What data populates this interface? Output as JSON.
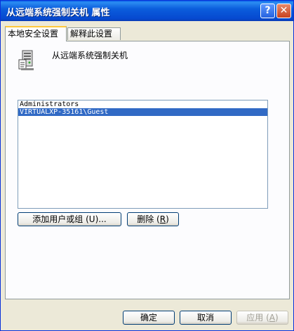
{
  "window": {
    "title": "从远端系统强制关机 属性",
    "help_label": "?",
    "close_label": "✕"
  },
  "tabs": [
    {
      "label": "本地安全设置",
      "active": true
    },
    {
      "label": "解释此设置",
      "active": false
    }
  ],
  "policy": {
    "icon": "server-policy-icon",
    "name": "从远端系统强制关机"
  },
  "accounts": [
    {
      "name": "Administrators",
      "selected": false
    },
    {
      "name": "VIRTUALXP-35161\\Guest",
      "selected": true
    }
  ],
  "buttons": {
    "add": {
      "text": "添加用户或组",
      "mnemonic": "(U)...",
      "pre": "",
      "key": "U",
      "post": ")..."
    },
    "remove": {
      "text": "删除",
      "key": "R"
    },
    "ok": "确定",
    "cancel": "取消",
    "apply": "应用",
    "apply_key": "A"
  },
  "colors": {
    "titlebar": "#0b5ddc",
    "selection": "#316ac5",
    "dialog_bg": "#ece9d8",
    "tab_highlight": "#ffc83c"
  }
}
